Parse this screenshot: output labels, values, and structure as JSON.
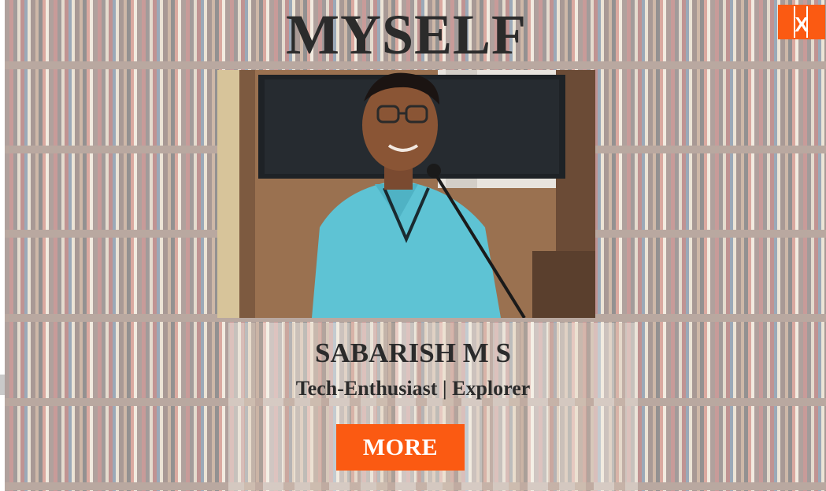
{
  "page": {
    "title": "MYSELF"
  },
  "close_button": {
    "label": "X",
    "color": "#fb5a12"
  },
  "profile": {
    "photo_alt": "Portrait photo",
    "name": "SABARISH M S",
    "tagline": "Tech-Enthusiast | Explorer"
  },
  "more_button": {
    "label": "MORE",
    "color": "#fb5a12"
  },
  "icons": {
    "close": "close-icon"
  }
}
